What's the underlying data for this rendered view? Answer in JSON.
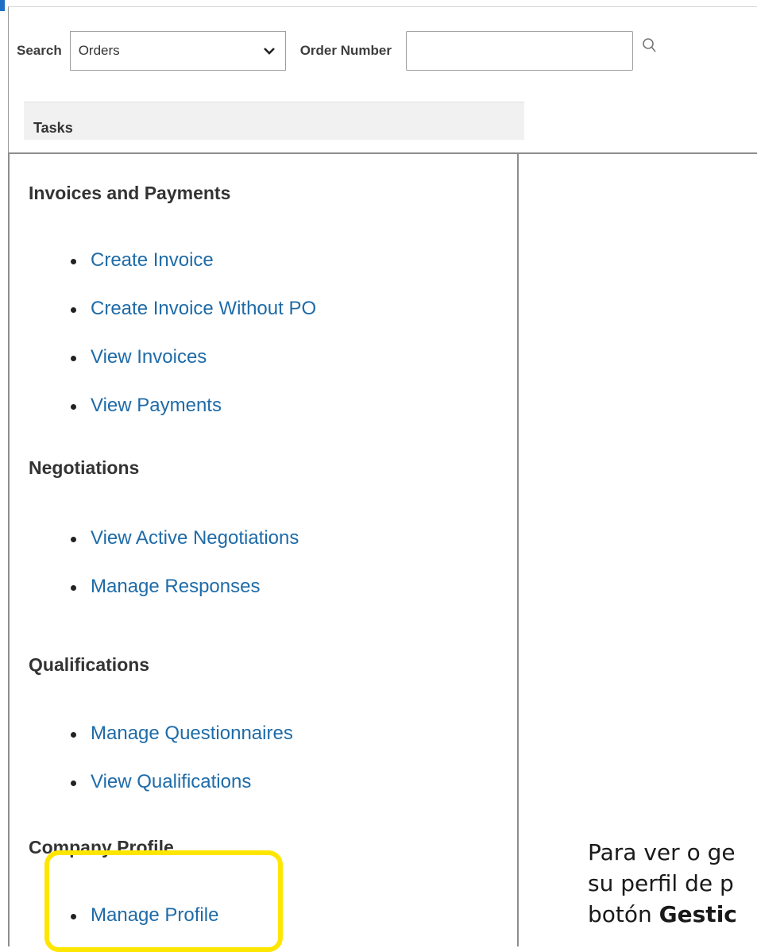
{
  "search": {
    "label": "Search",
    "selected": "Orders",
    "field_label": "Order Number",
    "field_value": ""
  },
  "tasks_tab": "Tasks",
  "sections": [
    {
      "title": "Invoices and Payments",
      "links": [
        "Create Invoice",
        "Create Invoice Without PO",
        "View Invoices",
        "View Payments"
      ]
    },
    {
      "title": "Negotiations",
      "links": [
        "View Active Negotiations",
        "Manage Responses"
      ]
    },
    {
      "title": "Qualifications",
      "links": [
        "Manage Questionnaires",
        "View Qualifications"
      ]
    },
    {
      "title": "Company Profile",
      "links": [
        "Manage Profile"
      ]
    }
  ],
  "caption": {
    "line1": "Para ver o ge",
    "line2": "su perfil de p",
    "line3_prefix": "botón ",
    "line3_bold": "Gestic"
  },
  "colors": {
    "link": "#1e6ba8",
    "highlight": "#ffe600",
    "accent": "#1f6fc5"
  },
  "icons": {
    "dropdown": "chevron-down-icon",
    "search": "magnifier-icon"
  }
}
